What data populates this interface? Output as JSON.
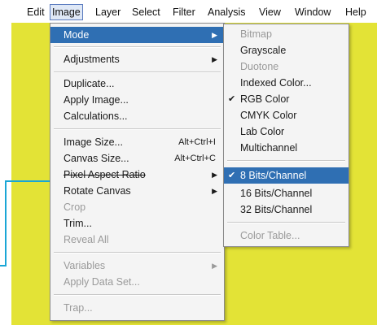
{
  "menubar": {
    "items": [
      "Edit",
      "Image",
      "Layer",
      "Select",
      "Filter",
      "Analysis",
      "View",
      "Window",
      "Help"
    ]
  },
  "image_menu": {
    "items": [
      {
        "label": "Mode",
        "submenu": true,
        "highlighted": true
      },
      {
        "label": "Adjustments",
        "submenu": true
      },
      {
        "label": "Duplicate..."
      },
      {
        "label": "Apply Image..."
      },
      {
        "label": "Calculations..."
      },
      {
        "label": "Image Size...",
        "shortcut": "Alt+Ctrl+I"
      },
      {
        "label": "Canvas Size...",
        "shortcut": "Alt+Ctrl+C"
      },
      {
        "label": "Pixel Aspect Ratio",
        "submenu": true
      },
      {
        "label": "Rotate Canvas",
        "submenu": true
      },
      {
        "label": "Crop",
        "disabled": true
      },
      {
        "label": "Trim..."
      },
      {
        "label": "Reveal All",
        "disabled": true
      },
      {
        "label": "Variables",
        "submenu": true,
        "disabled": true
      },
      {
        "label": "Apply Data Set...",
        "disabled": true
      },
      {
        "label": "Trap...",
        "disabled": true
      }
    ]
  },
  "mode_menu": {
    "items": [
      {
        "label": "Bitmap",
        "disabled": true
      },
      {
        "label": "Grayscale"
      },
      {
        "label": "Duotone",
        "disabled": true
      },
      {
        "label": "Indexed Color..."
      },
      {
        "label": "RGB Color",
        "checked": true
      },
      {
        "label": "CMYK Color"
      },
      {
        "label": "Lab Color"
      },
      {
        "label": "Multichannel"
      },
      {
        "label": "8 Bits/Channel",
        "checked": true,
        "highlighted": true
      },
      {
        "label": "16 Bits/Channel"
      },
      {
        "label": "32 Bits/Channel"
      },
      {
        "label": "Color Table...",
        "disabled": true
      }
    ],
    "check_glyph": "✔"
  },
  "glyphs": {
    "submenu_arrow": "▶"
  },
  "colors": {
    "background": "#e3e336",
    "highlight": "#2f6fb3",
    "callout_line": "#1aa6d6"
  }
}
